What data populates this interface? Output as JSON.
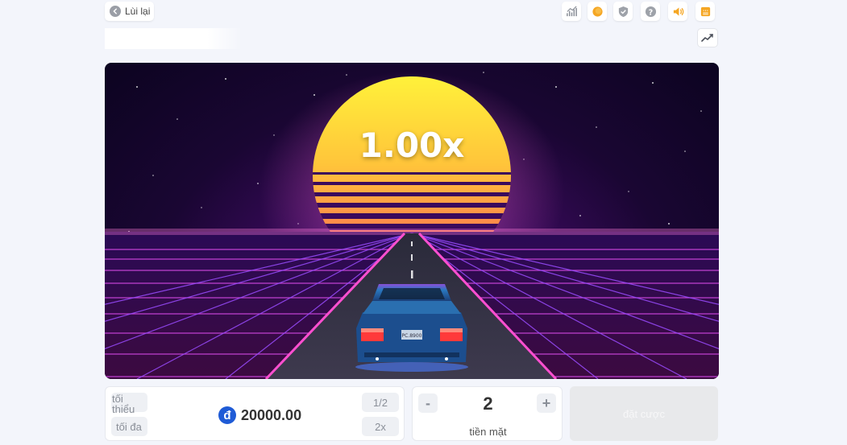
{
  "header": {
    "back_label": "Lùi lại",
    "icons": [
      "stats-icon",
      "coin-icon",
      "shield-icon",
      "help-icon",
      "sound-icon",
      "chat-icon"
    ]
  },
  "colors": {
    "accent_orange": "#f5a623",
    "icon_gray": "#a0a4ab",
    "coin_blue": "#1f5bd6"
  },
  "game": {
    "multiplier": "1.00x",
    "car_plate": "PC.8900"
  },
  "controls": {
    "min_label": "tối thiểu",
    "max_label": "tối đa",
    "amount": "20000.00",
    "currency_symbol": "đ",
    "half_label": "1/2",
    "double_label": "2x",
    "count_value": "2",
    "minus_label": "-",
    "plus_label": "+",
    "count_label": "tiền mặt",
    "bet_label": "đặt cược"
  }
}
